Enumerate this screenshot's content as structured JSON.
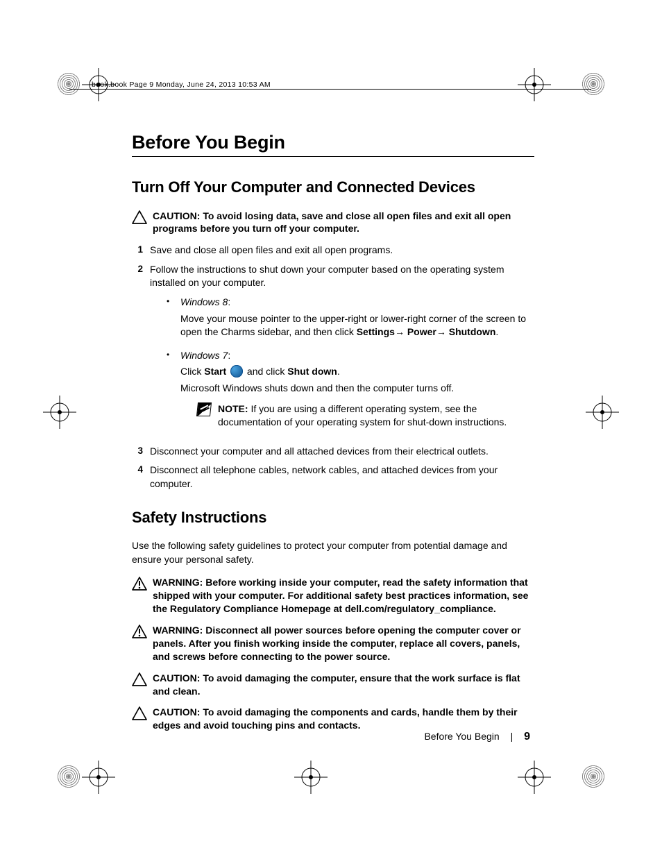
{
  "header_line": "book.book  Page 9  Monday, June 24, 2013  10:53 AM",
  "h1": "Before You Begin",
  "section1": {
    "title": "Turn Off Your Computer and Connected Devices",
    "caution": {
      "label": "CAUTION:",
      "text": "To avoid losing data, save and close all open files and exit all open programs before you turn off your computer."
    },
    "steps": [
      {
        "num": "1",
        "text": "Save and close all open files and exit all open programs."
      },
      {
        "num": "2",
        "text": "Follow the instructions to shut down your computer based on the operating system installed on your computer."
      },
      {
        "num": "3",
        "text": "Disconnect your computer and all attached devices from their electrical outlets."
      },
      {
        "num": "4",
        "text": "Disconnect all telephone cables, network cables, and attached devices from your computer."
      }
    ],
    "sub": {
      "win8_label": "Windows 8",
      "win8_text_a": "Move your mouse pointer to the upper-right or lower-right corner of the screen to open the Charms sidebar, and then click ",
      "win8_settings": "Settings",
      "win8_power": "  Power",
      "win8_shutdown": "Shutdown",
      "win7_label": "Windows 7",
      "win7_click": "Click ",
      "win7_start": "Start",
      "win7_and": " and click ",
      "win7_shutdown": "Shut down",
      "win7_after": "Microsoft Windows shuts down and then the computer turns off.",
      "note_label": "NOTE:",
      "note_text": " If you are using a different operating system, see the documentation of your operating system for shut-down instructions."
    }
  },
  "section2": {
    "title": "Safety Instructions",
    "intro": "Use the following safety guidelines to protect your computer from potential damage and ensure your personal safety.",
    "w1": {
      "label": "WARNING:",
      "text": "  Before working inside your computer, read the safety information that shipped with your computer. For additional safety best practices information, see the Regulatory Compliance Homepage at dell.com/regulatory_compliance."
    },
    "w2": {
      "label": "WARNING:",
      "text": "  Disconnect all power sources before opening the computer cover or panels. After you finish working inside the computer, replace all covers, panels, and screws before connecting to the power source."
    },
    "c1": {
      "label": "CAUTION:",
      "text": " To avoid damaging the computer, ensure that the work surface is flat and clean."
    },
    "c2": {
      "label": "CAUTION:",
      "text": " To avoid damaging the components and cards, handle them by their edges and avoid touching pins and contacts."
    }
  },
  "footer": {
    "title": "Before You Begin",
    "page": "9"
  }
}
